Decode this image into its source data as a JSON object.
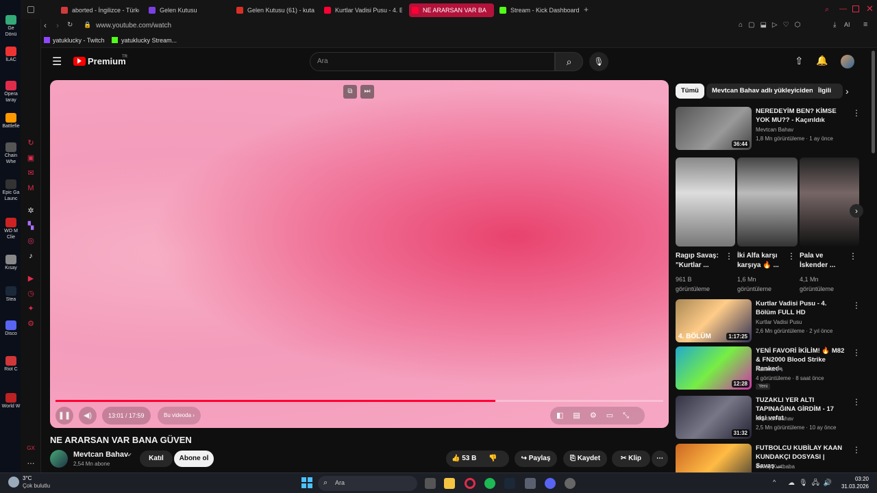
{
  "desktop": {
    "icons": [
      "Ge Dönü",
      "İLAC",
      "Opera taray",
      "Battlefie",
      "Chain Whe",
      "Epic Ga Launc",
      "WO M Clie",
      "Kısay",
      "Stea",
      "Disco",
      "Riot C",
      "World W"
    ]
  },
  "tabs": [
    {
      "label": "aborted - İngilizce - Türkç",
      "color": "#d23b3b"
    },
    {
      "label": "Gelen Kutusu",
      "color": "#7b3fe4"
    },
    {
      "label": "Gelen Kutusu (61) - kutay",
      "color": "#d93025"
    },
    {
      "label": "Kurtlar Vadisi Pusu - 4. Bö",
      "color": "#ff0033"
    },
    {
      "label": "NE ARARSAN VAR BA",
      "color": "#ff0033"
    },
    {
      "label": "Stream - Kick Dashboard",
      "color": "#53fc18"
    }
  ],
  "address": {
    "url": "www.youtube.com/watch",
    "ai_label": "AI"
  },
  "bookmarks": [
    {
      "label": "yatuklucky - Twitch"
    },
    {
      "label": "yatuklucky Stream..."
    }
  ],
  "yt": {
    "logo": "Premium",
    "region": "TR",
    "search_placeholder": "Ara",
    "player": {
      "time": "13:01 / 17:59",
      "chapter": "Bu videoda",
      "progress": 0.724
    },
    "title": "NE ARARSAN VAR BANA GÜVEN",
    "channel": {
      "name": "Mevtcan Bahav",
      "subs": "2,54 Mn abone",
      "join": "Katıl",
      "subscribe": "Abone ol"
    },
    "actions": {
      "likes": "53 B",
      "share": "Paylaş",
      "save": "Kaydet",
      "clip": "Klip"
    },
    "chips": [
      "Tümü",
      "Mevtcan Bahav adlı yükleyiciden",
      "İlgili"
    ],
    "recs_top": [
      {
        "title": "NEREDEYİM BEN? KİMSE YOK MU?? - Kaçırıldık",
        "channel": "Mevtcan Bahav",
        "meta": "1,8 Mn görüntüleme · 1 ay önce",
        "dur": "36:44"
      }
    ],
    "shorts": [
      {
        "title": "Ragıp Savaş: \"Kurtlar ...",
        "views": "961 B görüntüleme"
      },
      {
        "title": "İki Alfa karşı karşıya 🔥 ...",
        "views": "1,6 Mn görüntüleme"
      },
      {
        "title": "Pala ve İskender ...",
        "views": "4,1 Mn görüntüleme"
      }
    ],
    "recs": [
      {
        "title": "Kurtlar Vadisi Pusu - 4. Bölüm FULL HD",
        "channel": "Kurtlar Vadisi Pusu",
        "meta": "2,6 Mn görüntüleme · 2 yıl önce",
        "dur": "1:17:25",
        "overlay": "4. BÖLÜM",
        "badge": ""
      },
      {
        "title": "YENİ FAVORİ İKİLİM! 🔥 M82 & FN2000 Blood Strike Ranked",
        "channel": "Rahmet 🎮",
        "meta": "4 görüntüleme · 8 saat önce",
        "dur": "12:28",
        "overlay": "",
        "badge": "Yeni"
      },
      {
        "title": "TUZAKLI YER ALTI TAPINAĞINA GİRDİM - 17 kişi vefat",
        "channel": "Mevtcan Bahav",
        "meta": "2,5 Mn görüntüleme · 10 ay önce",
        "dur": "31:32",
        "overlay": "",
        "badge": ""
      },
      {
        "title": "FUTBOLCU KUBİLAY KAAN KUNDAKÇI DOSYASI | Savaş ...",
        "channel": "Savaş Kurtbaba",
        "meta": "",
        "dur": "",
        "overlay": "",
        "badge": ""
      }
    ]
  },
  "taskbar": {
    "weather_temp": "3°C",
    "weather_desc": "Çok bulutlu",
    "search": "Ara",
    "time": "03:20",
    "date": "31.03.2026"
  }
}
